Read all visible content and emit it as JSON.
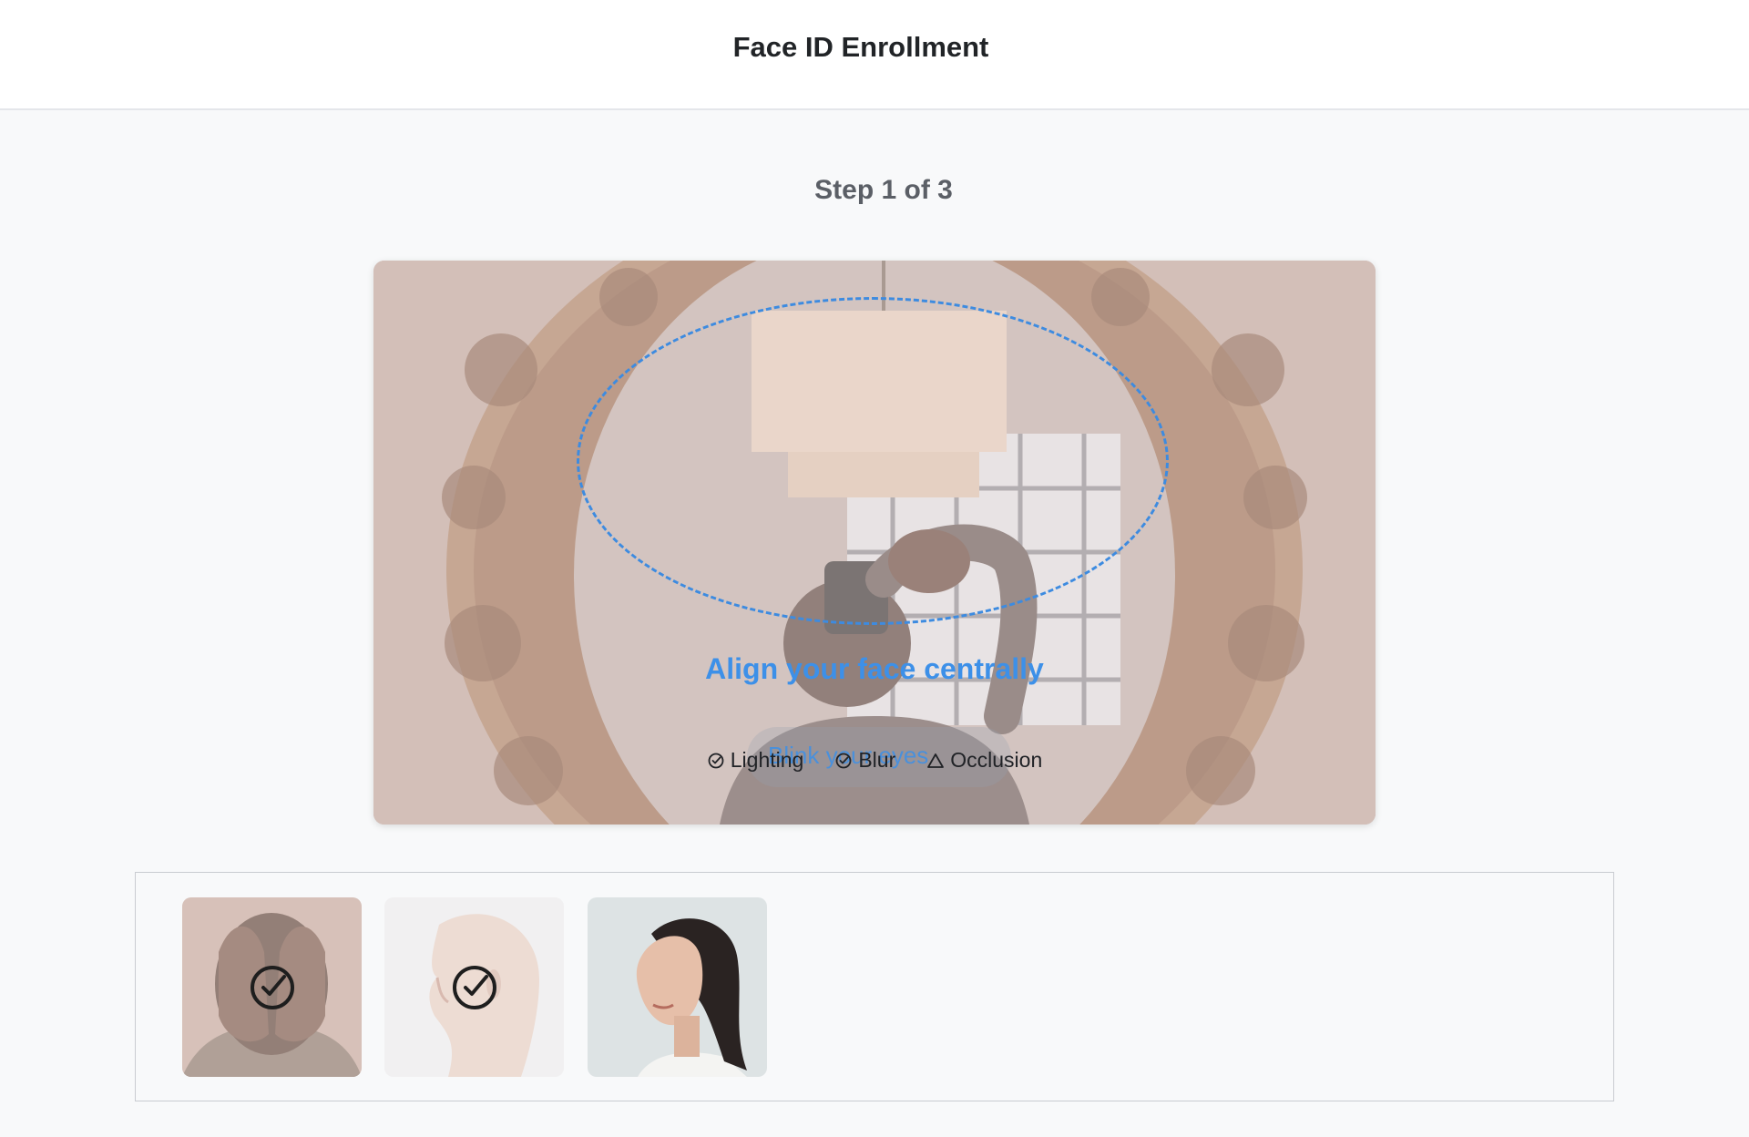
{
  "header": {
    "title": "Face ID Enrollment"
  },
  "progress": {
    "step_text": "Step 1 of 3",
    "current_step": 1,
    "total_steps": 3
  },
  "camera": {
    "instruction": "Align your face centrally",
    "prompt": "Blink your eyes",
    "checks": [
      {
        "label": "Lighting",
        "status": "ok",
        "icon": "check-circle-icon"
      },
      {
        "label": "Blur",
        "status": "ok",
        "icon": "check-circle-icon"
      },
      {
        "label": "Occlusion",
        "status": "warning",
        "icon": "warning-triangle-icon"
      }
    ],
    "guide_color": "#3d8be0"
  },
  "captures": [
    {
      "pose": "covered face",
      "status": "captured",
      "icon": "check-circle-icon"
    },
    {
      "pose": "side profile",
      "status": "captured",
      "icon": "check-circle-icon"
    },
    {
      "pose": "three-quarter profile",
      "status": "pending"
    }
  ],
  "colors": {
    "accent": "#3d90e8",
    "header_bg": "#ffffff",
    "page_bg": "#f8f9fa"
  }
}
